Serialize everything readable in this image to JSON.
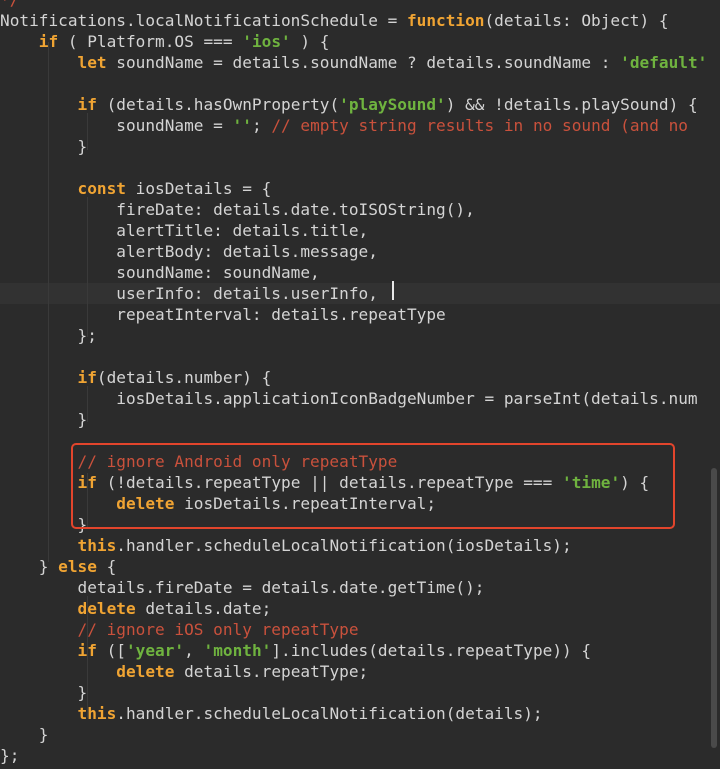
{
  "editor": {
    "language": "javascript",
    "theme": {
      "background": "#2b2b2b",
      "keyword": "#f0a433",
      "string": "#6fb33f",
      "comment": "#c9513c",
      "text": "#d4d4d4",
      "annotation": "#e2452c"
    },
    "lines": [
      [
        {
          "c": "t-com",
          "t": "*/"
        }
      ],
      [
        {
          "c": "t-id",
          "t": "Notifications.localNotificationSchedule = "
        },
        {
          "c": "t-kw",
          "t": "function"
        },
        {
          "c": "t-id",
          "t": "(details: Object) {"
        }
      ],
      [
        {
          "c": "t-id",
          "t": "    "
        },
        {
          "c": "t-kw",
          "t": "if"
        },
        {
          "c": "t-id",
          "t": " ( Platform.OS === "
        },
        {
          "c": "t-str",
          "t": "'ios'"
        },
        {
          "c": "t-id",
          "t": " ) {"
        }
      ],
      [
        {
          "c": "t-id",
          "t": "        "
        },
        {
          "c": "t-kw",
          "t": "let"
        },
        {
          "c": "t-id",
          "t": " soundName = details.soundName ? details.soundName : "
        },
        {
          "c": "t-str",
          "t": "'default'"
        }
      ],
      [],
      [
        {
          "c": "t-id",
          "t": "        "
        },
        {
          "c": "t-kw",
          "t": "if"
        },
        {
          "c": "t-id",
          "t": " (details.hasOwnProperty("
        },
        {
          "c": "t-str",
          "t": "'playSound'"
        },
        {
          "c": "t-id",
          "t": ") && !details.playSound) {"
        }
      ],
      [
        {
          "c": "t-id",
          "t": "            soundName = "
        },
        {
          "c": "t-str",
          "t": "''"
        },
        {
          "c": "t-id",
          "t": "; "
        },
        {
          "c": "t-com",
          "t": "// empty string results in no sound (and no"
        }
      ],
      [
        {
          "c": "t-id",
          "t": "        }"
        }
      ],
      [],
      [
        {
          "c": "t-id",
          "t": "        "
        },
        {
          "c": "t-kw",
          "t": "const"
        },
        {
          "c": "t-id",
          "t": " iosDetails = {"
        }
      ],
      [
        {
          "c": "t-id",
          "t": "            fireDate: details.date.toISOString(),"
        }
      ],
      [
        {
          "c": "t-id",
          "t": "            alertTitle: details.title,"
        }
      ],
      [
        {
          "c": "t-id",
          "t": "            alertBody: details.message,"
        }
      ],
      [
        {
          "c": "t-id",
          "t": "            soundName: soundName,"
        }
      ],
      [
        {
          "c": "t-id",
          "t": "            userInfo: details.userInfo,"
        }
      ],
      [
        {
          "c": "t-id",
          "t": "            repeatInterval: details.repeatType"
        }
      ],
      [
        {
          "c": "t-id",
          "t": "        };"
        }
      ],
      [],
      [
        {
          "c": "t-id",
          "t": "        "
        },
        {
          "c": "t-kw",
          "t": "if"
        },
        {
          "c": "t-id",
          "t": "(details.number) {"
        }
      ],
      [
        {
          "c": "t-id",
          "t": "            iosDetails.applicationIconBadgeNumber = parseInt(details.num"
        }
      ],
      [
        {
          "c": "t-id",
          "t": "        }"
        }
      ],
      [],
      [
        {
          "c": "t-id",
          "t": "        "
        },
        {
          "c": "t-com",
          "t": "// ignore Android only repeatType"
        }
      ],
      [
        {
          "c": "t-id",
          "t": "        "
        },
        {
          "c": "t-kw",
          "t": "if"
        },
        {
          "c": "t-id",
          "t": " (!details.repeatType || details.repeatType === "
        },
        {
          "c": "t-str",
          "t": "'time'"
        },
        {
          "c": "t-id",
          "t": ") {"
        }
      ],
      [
        {
          "c": "t-id",
          "t": "            "
        },
        {
          "c": "t-kw",
          "t": "delete"
        },
        {
          "c": "t-id",
          "t": " iosDetails.repeatInterval;"
        }
      ],
      [
        {
          "c": "t-id",
          "t": "        }"
        }
      ],
      [
        {
          "c": "t-id",
          "t": "        "
        },
        {
          "c": "t-kw",
          "t": "this"
        },
        {
          "c": "t-id",
          "t": ".handler.scheduleLocalNotification(iosDetails);"
        }
      ],
      [
        {
          "c": "t-id",
          "t": "    } "
        },
        {
          "c": "t-kw",
          "t": "else"
        },
        {
          "c": "t-id",
          "t": " {"
        }
      ],
      [
        {
          "c": "t-id",
          "t": "        details.fireDate = details.date.getTime();"
        }
      ],
      [
        {
          "c": "t-id",
          "t": "        "
        },
        {
          "c": "t-kw",
          "t": "delete"
        },
        {
          "c": "t-id",
          "t": " details.date;"
        }
      ],
      [
        {
          "c": "t-id",
          "t": "        "
        },
        {
          "c": "t-com",
          "t": "// ignore iOS only repeatType"
        }
      ],
      [
        {
          "c": "t-id",
          "t": "        "
        },
        {
          "c": "t-kw",
          "t": "if"
        },
        {
          "c": "t-id",
          "t": " (["
        },
        {
          "c": "t-str",
          "t": "'year'"
        },
        {
          "c": "t-id",
          "t": ", "
        },
        {
          "c": "t-str",
          "t": "'month'"
        },
        {
          "c": "t-id",
          "t": "].includes(details.repeatType)) {"
        }
      ],
      [
        {
          "c": "t-id",
          "t": "            "
        },
        {
          "c": "t-kw",
          "t": "delete"
        },
        {
          "c": "t-id",
          "t": " details.repeatType;"
        }
      ],
      [
        {
          "c": "t-id",
          "t": "        }"
        }
      ],
      [
        {
          "c": "t-id",
          "t": "        "
        },
        {
          "c": "t-kw",
          "t": "this"
        },
        {
          "c": "t-id",
          "t": ".handler.scheduleLocalNotification(details);"
        }
      ],
      [
        {
          "c": "t-id",
          "t": "    }"
        }
      ],
      [
        {
          "c": "t-id",
          "t": "};"
        }
      ]
    ],
    "current_line_index": 14
  }
}
